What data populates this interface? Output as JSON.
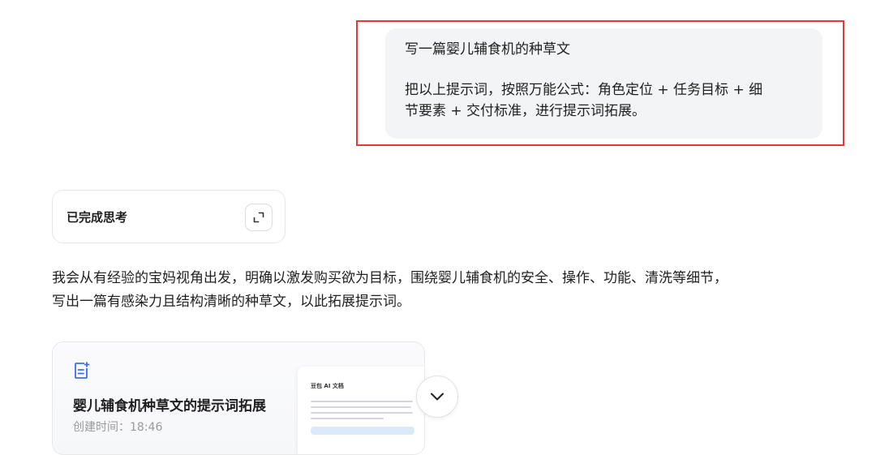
{
  "user_message": {
    "line1": "写一篇婴儿辅食机的种草文",
    "line2": "把以上提示词，按照万能公式：角色定位 + 任务目标 + 细",
    "line3": "节要素 + 交付标准，进行提示词拓展。"
  },
  "thinking": {
    "label": "已完成思考",
    "expand_icon": "expand-icon"
  },
  "answer": {
    "line1": "我会从有经验的宝妈视角出发，明确以激发购买欲为目标，围绕婴儿辅食机的安全、操作、功能、清洗等细节，",
    "line2": "写出一篇有感染力且结构清晰的种草文，以此拓展提示词。"
  },
  "document_card": {
    "icon": "ai-document-icon",
    "title": "婴儿辅食机种草文的提示词拓展",
    "created_time": "创建时间：18:46",
    "preview_title": "豆包 AI 文档"
  },
  "collapse_button": {
    "icon": "chevron-down-icon"
  },
  "colors": {
    "highlight_border": "#e53935",
    "bubble_bg": "#f3f4f6",
    "accent_blue": "#3b6cf6"
  }
}
